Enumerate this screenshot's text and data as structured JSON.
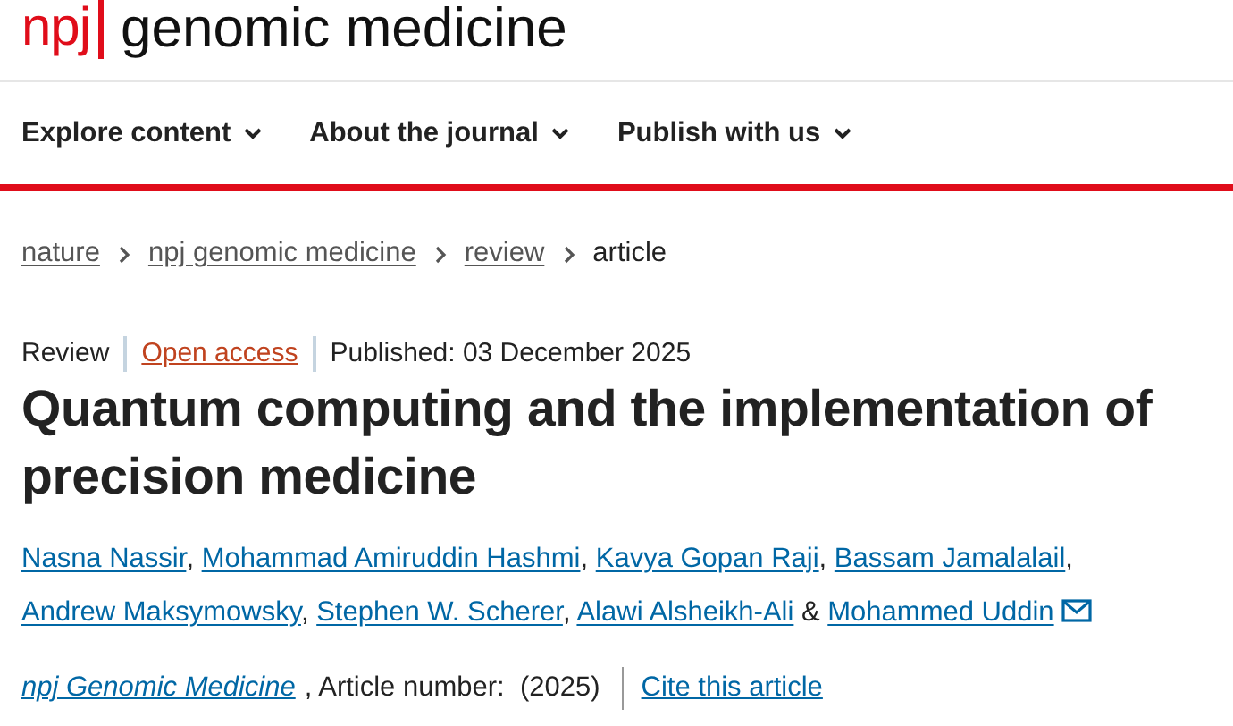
{
  "logo": {
    "mark": "npj",
    "name": "genomic medicine"
  },
  "nav": [
    {
      "label": "Explore content"
    },
    {
      "label": "About the journal"
    },
    {
      "label": "Publish with us"
    }
  ],
  "breadcrumb": [
    {
      "label": "nature",
      "kind": "link"
    },
    {
      "label": "npj genomic medicine",
      "kind": "link"
    },
    {
      "label": "review",
      "kind": "link"
    },
    {
      "label": "article",
      "kind": "current"
    }
  ],
  "article": {
    "type": "Review",
    "access": "Open access",
    "published": "Published: 03 December 2025",
    "title": "Quantum computing and the implementation of precision medicine",
    "authors": [
      {
        "name": "Nasna Nassir",
        "sep": ","
      },
      {
        "name": "Mohammad Amiruddin Hashmi",
        "sep": ","
      },
      {
        "name": "Kavya Gopan Raji",
        "sep": ","
      },
      {
        "name": "Bassam Jamalalail",
        "sep": ","
      },
      {
        "name": "Andrew Maksymowsky",
        "sep": ","
      },
      {
        "name": "Stephen W. Scherer",
        "sep": ","
      },
      {
        "name": "Alawi Alsheikh-Ali",
        "sep": " &"
      },
      {
        "name": "Mohammed Uddin",
        "contact": true
      }
    ],
    "journal": "npj Genomic Medicine",
    "article_number": ", Article number:  (2025)",
    "cite": "Cite this article"
  }
}
